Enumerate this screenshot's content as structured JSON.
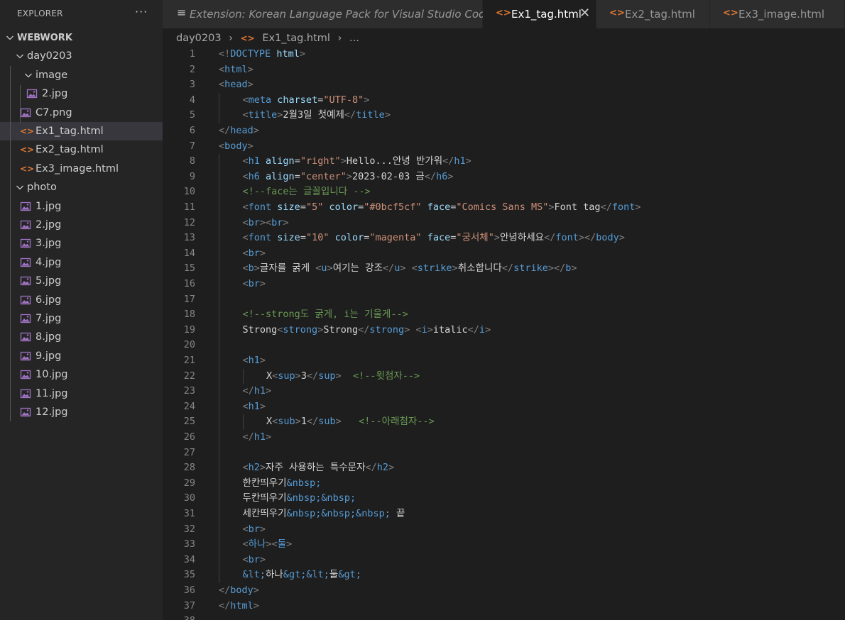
{
  "colors": {
    "tag": "#569cd6",
    "bracket": "#808080",
    "attribute": "#9cdcfe",
    "string": "#ce9178",
    "text": "#d4d4d4",
    "comment": "#6a9955",
    "html_icon": "#e37933",
    "image_icon": "#a074c4"
  },
  "sidebar": {
    "title": "EXPLORER",
    "more": "···",
    "tree": [
      {
        "label": "WEBWORK",
        "depth": 0,
        "kind": "folder",
        "expanded": true,
        "bold": true
      },
      {
        "label": "day0203",
        "depth": 1,
        "kind": "folder",
        "expanded": true
      },
      {
        "label": "image",
        "depth": 2,
        "kind": "folder",
        "expanded": true
      },
      {
        "label": "2.jpg",
        "depth": 3,
        "kind": "image"
      },
      {
        "label": "C7.png",
        "depth": 2,
        "kind": "image"
      },
      {
        "label": "Ex1_tag.html",
        "depth": 2,
        "kind": "html",
        "selected": true
      },
      {
        "label": "Ex2_tag.html",
        "depth": 2,
        "kind": "html"
      },
      {
        "label": "Ex3_image.html",
        "depth": 2,
        "kind": "html"
      },
      {
        "label": "photo",
        "depth": 1,
        "kind": "folder",
        "expanded": true
      },
      {
        "label": "1.jpg",
        "depth": 2,
        "kind": "image"
      },
      {
        "label": "2.jpg",
        "depth": 2,
        "kind": "image"
      },
      {
        "label": "3.jpg",
        "depth": 2,
        "kind": "image"
      },
      {
        "label": "4.jpg",
        "depth": 2,
        "kind": "image"
      },
      {
        "label": "5.jpg",
        "depth": 2,
        "kind": "image"
      },
      {
        "label": "6.jpg",
        "depth": 2,
        "kind": "image"
      },
      {
        "label": "7.jpg",
        "depth": 2,
        "kind": "image"
      },
      {
        "label": "8.jpg",
        "depth": 2,
        "kind": "image"
      },
      {
        "label": "9.jpg",
        "depth": 2,
        "kind": "image"
      },
      {
        "label": "10.jpg",
        "depth": 2,
        "kind": "image"
      },
      {
        "label": "11.jpg",
        "depth": 2,
        "kind": "image"
      },
      {
        "label": "12.jpg",
        "depth": 2,
        "kind": "image"
      }
    ]
  },
  "tabs": [
    {
      "label": "Extension: Korean Language Pack for Visual Studio Code",
      "icon": "≡",
      "kind": "extension",
      "italic": true
    },
    {
      "label": "Ex1_tag.html",
      "icon": "<>",
      "kind": "html",
      "active": true,
      "close": "✕"
    },
    {
      "label": "Ex2_tag.html",
      "icon": "<>",
      "kind": "html"
    },
    {
      "label": "Ex3_image.html",
      "icon": "<>",
      "kind": "html"
    }
  ],
  "breadcrumb": {
    "folder": "day0203",
    "file": "Ex1_tag.html",
    "symbol": "...",
    "separator": "›",
    "file_icon": "<>"
  },
  "editor": {
    "lines": [
      {
        "n": "1",
        "indent": 0,
        "tokens": [
          [
            "br",
            "<!"
          ],
          [
            "doc",
            "DOCTYPE"
          ],
          [
            "txt",
            " "
          ],
          [
            "attr",
            "html"
          ],
          [
            "br",
            ">"
          ]
        ]
      },
      {
        "n": "2",
        "indent": 0,
        "tokens": [
          [
            "br",
            "<"
          ],
          [
            "tag",
            "html"
          ],
          [
            "br",
            ">"
          ]
        ]
      },
      {
        "n": "3",
        "indent": 0,
        "tokens": [
          [
            "br",
            "<"
          ],
          [
            "tag",
            "head"
          ],
          [
            "br",
            ">"
          ]
        ]
      },
      {
        "n": "4",
        "indent": 1,
        "tokens": [
          [
            "br",
            "<"
          ],
          [
            "tag",
            "meta"
          ],
          [
            "txt",
            " "
          ],
          [
            "attr",
            "charset"
          ],
          [
            "txt",
            "="
          ],
          [
            "str",
            "\"UTF-8\""
          ],
          [
            "br",
            ">"
          ]
        ]
      },
      {
        "n": "5",
        "indent": 1,
        "tokens": [
          [
            "br",
            "<"
          ],
          [
            "tag",
            "title"
          ],
          [
            "br",
            ">"
          ],
          [
            "txt",
            "2월3일 첫예제"
          ],
          [
            "br",
            "</"
          ],
          [
            "tag",
            "title"
          ],
          [
            "br",
            ">"
          ]
        ]
      },
      {
        "n": "6",
        "indent": 0,
        "tokens": [
          [
            "br",
            "</"
          ],
          [
            "tag",
            "head"
          ],
          [
            "br",
            ">"
          ]
        ]
      },
      {
        "n": "7",
        "indent": 0,
        "tokens": [
          [
            "br",
            "<"
          ],
          [
            "tag",
            "body"
          ],
          [
            "br",
            ">"
          ]
        ]
      },
      {
        "n": "8",
        "indent": 1,
        "tokens": [
          [
            "br",
            "<"
          ],
          [
            "tag",
            "h1"
          ],
          [
            "txt",
            " "
          ],
          [
            "attr",
            "align"
          ],
          [
            "txt",
            "="
          ],
          [
            "str",
            "\"right\""
          ],
          [
            "br",
            ">"
          ],
          [
            "txt",
            "Hello...안녕 반가워"
          ],
          [
            "br",
            "</"
          ],
          [
            "tag",
            "h1"
          ],
          [
            "br",
            ">"
          ]
        ]
      },
      {
        "n": "9",
        "indent": 1,
        "tokens": [
          [
            "br",
            "<"
          ],
          [
            "tag",
            "h6"
          ],
          [
            "txt",
            " "
          ],
          [
            "attr",
            "align"
          ],
          [
            "txt",
            "="
          ],
          [
            "str",
            "\"center\""
          ],
          [
            "br",
            ">"
          ],
          [
            "txt",
            "2023-02-03 금"
          ],
          [
            "br",
            "</"
          ],
          [
            "tag",
            "h6"
          ],
          [
            "br",
            ">"
          ]
        ]
      },
      {
        "n": "10",
        "indent": 1,
        "tokens": [
          [
            "cmt",
            "<!--face는 글꼴입니다 -->"
          ]
        ]
      },
      {
        "n": "11",
        "indent": 1,
        "tokens": [
          [
            "br",
            "<"
          ],
          [
            "tag",
            "font"
          ],
          [
            "txt",
            " "
          ],
          [
            "attr",
            "size"
          ],
          [
            "txt",
            "="
          ],
          [
            "str",
            "\"5\""
          ],
          [
            "txt",
            " "
          ],
          [
            "attr",
            "color"
          ],
          [
            "txt",
            "="
          ],
          [
            "str",
            "\"#0bcf5cf\""
          ],
          [
            "txt",
            " "
          ],
          [
            "attr",
            "face"
          ],
          [
            "txt",
            "="
          ],
          [
            "str",
            "\"Comics Sans MS\""
          ],
          [
            "br",
            ">"
          ],
          [
            "txt",
            "Font tag"
          ],
          [
            "br",
            "</"
          ],
          [
            "tag",
            "font"
          ],
          [
            "br",
            ">"
          ]
        ]
      },
      {
        "n": "12",
        "indent": 1,
        "tokens": [
          [
            "br",
            "<"
          ],
          [
            "tag",
            "br"
          ],
          [
            "br",
            "><"
          ],
          [
            "tag",
            "br"
          ],
          [
            "br",
            ">"
          ]
        ]
      },
      {
        "n": "13",
        "indent": 1,
        "tokens": [
          [
            "br",
            "<"
          ],
          [
            "tag",
            "font"
          ],
          [
            "txt",
            " "
          ],
          [
            "attr",
            "size"
          ],
          [
            "txt",
            "="
          ],
          [
            "str",
            "\"10\""
          ],
          [
            "txt",
            " "
          ],
          [
            "attr",
            "color"
          ],
          [
            "txt",
            "="
          ],
          [
            "str",
            "\"magenta\""
          ],
          [
            "txt",
            " "
          ],
          [
            "attr",
            "face"
          ],
          [
            "txt",
            "="
          ],
          [
            "str",
            "\"궁서체\""
          ],
          [
            "br",
            ">"
          ],
          [
            "txt",
            "안녕하세요"
          ],
          [
            "br",
            "</"
          ],
          [
            "tag",
            "font"
          ],
          [
            "br",
            "></"
          ],
          [
            "tag",
            "body"
          ],
          [
            "br",
            ">"
          ]
        ]
      },
      {
        "n": "14",
        "indent": 1,
        "tokens": [
          [
            "br",
            "<"
          ],
          [
            "tag",
            "br"
          ],
          [
            "br",
            ">"
          ]
        ]
      },
      {
        "n": "15",
        "indent": 1,
        "tokens": [
          [
            "br",
            "<"
          ],
          [
            "tag",
            "b"
          ],
          [
            "br",
            ">"
          ],
          [
            "txt",
            "글자를 굵게 "
          ],
          [
            "br",
            "<"
          ],
          [
            "tag",
            "u"
          ],
          [
            "br",
            ">"
          ],
          [
            "txt",
            "여기는 강조"
          ],
          [
            "br",
            "</"
          ],
          [
            "tag",
            "u"
          ],
          [
            "br",
            ">"
          ],
          [
            "txt",
            " "
          ],
          [
            "br",
            "<"
          ],
          [
            "tag",
            "strike"
          ],
          [
            "br",
            ">"
          ],
          [
            "txt",
            "취소합니다"
          ],
          [
            "br",
            "</"
          ],
          [
            "tag",
            "strike"
          ],
          [
            "br",
            "></"
          ],
          [
            "tag",
            "b"
          ],
          [
            "br",
            ">"
          ]
        ]
      },
      {
        "n": "16",
        "indent": 1,
        "tokens": [
          [
            "br",
            "<"
          ],
          [
            "tag",
            "br"
          ],
          [
            "br",
            ">"
          ]
        ]
      },
      {
        "n": "17",
        "indent": 1,
        "tokens": []
      },
      {
        "n": "18",
        "indent": 1,
        "tokens": [
          [
            "cmt",
            "<!--strong도 굵게, i는 기울게-->"
          ]
        ]
      },
      {
        "n": "19",
        "indent": 1,
        "tokens": [
          [
            "txt",
            "Strong"
          ],
          [
            "br",
            "<"
          ],
          [
            "tag",
            "strong"
          ],
          [
            "br",
            ">"
          ],
          [
            "txt",
            "Strong"
          ],
          [
            "br",
            "</"
          ],
          [
            "tag",
            "strong"
          ],
          [
            "br",
            ">"
          ],
          [
            "txt",
            " "
          ],
          [
            "br",
            "<"
          ],
          [
            "tag",
            "i"
          ],
          [
            "br",
            ">"
          ],
          [
            "txt",
            "italic"
          ],
          [
            "br",
            "</"
          ],
          [
            "tag",
            "i"
          ],
          [
            "br",
            ">"
          ]
        ]
      },
      {
        "n": "20",
        "indent": 1,
        "tokens": []
      },
      {
        "n": "21",
        "indent": 1,
        "tokens": [
          [
            "br",
            "<"
          ],
          [
            "tag",
            "h1"
          ],
          [
            "br",
            ">"
          ]
        ]
      },
      {
        "n": "22",
        "indent": 2,
        "tokens": [
          [
            "txt",
            "X"
          ],
          [
            "br",
            "<"
          ],
          [
            "tag",
            "sup"
          ],
          [
            "br",
            ">"
          ],
          [
            "txt",
            "3"
          ],
          [
            "br",
            "</"
          ],
          [
            "tag",
            "sup"
          ],
          [
            "br",
            ">"
          ],
          [
            "txt",
            "  "
          ],
          [
            "cmt",
            "<!--윗첨자-->"
          ]
        ]
      },
      {
        "n": "23",
        "indent": 1,
        "tokens": [
          [
            "br",
            "</"
          ],
          [
            "tag",
            "h1"
          ],
          [
            "br",
            ">"
          ]
        ]
      },
      {
        "n": "24",
        "indent": 1,
        "tokens": [
          [
            "br",
            "<"
          ],
          [
            "tag",
            "h1"
          ],
          [
            "br",
            ">"
          ]
        ]
      },
      {
        "n": "25",
        "indent": 2,
        "tokens": [
          [
            "txt",
            "X"
          ],
          [
            "br",
            "<"
          ],
          [
            "tag",
            "sub"
          ],
          [
            "br",
            ">"
          ],
          [
            "txt",
            "1"
          ],
          [
            "br",
            "</"
          ],
          [
            "tag",
            "sub"
          ],
          [
            "br",
            ">"
          ],
          [
            "txt",
            "   "
          ],
          [
            "cmt",
            "<!--아래첨자-->"
          ]
        ]
      },
      {
        "n": "26",
        "indent": 1,
        "tokens": [
          [
            "br",
            "</"
          ],
          [
            "tag",
            "h1"
          ],
          [
            "br",
            ">"
          ]
        ]
      },
      {
        "n": "27",
        "indent": 1,
        "tokens": []
      },
      {
        "n": "28",
        "indent": 1,
        "tokens": [
          [
            "br",
            "<"
          ],
          [
            "tag",
            "h2"
          ],
          [
            "br",
            ">"
          ],
          [
            "txt",
            "자주 사용하는 특수문자"
          ],
          [
            "br",
            "</"
          ],
          [
            "tag",
            "h2"
          ],
          [
            "br",
            ">"
          ]
        ]
      },
      {
        "n": "29",
        "indent": 1,
        "tokens": [
          [
            "txt",
            "한칸띄우기"
          ],
          [
            "ent",
            "&nbsp;"
          ]
        ]
      },
      {
        "n": "30",
        "indent": 1,
        "tokens": [
          [
            "txt",
            "두칸띄우기"
          ],
          [
            "ent",
            "&nbsp;&nbsp;"
          ]
        ]
      },
      {
        "n": "31",
        "indent": 1,
        "tokens": [
          [
            "txt",
            "세칸띄우기"
          ],
          [
            "ent",
            "&nbsp;&nbsp;&nbsp;"
          ],
          [
            "txt",
            " 끝"
          ]
        ]
      },
      {
        "n": "32",
        "indent": 1,
        "tokens": [
          [
            "br",
            "<"
          ],
          [
            "tag",
            "br"
          ],
          [
            "br",
            ">"
          ]
        ]
      },
      {
        "n": "33",
        "indent": 1,
        "tokens": [
          [
            "br",
            "<"
          ],
          [
            "tag",
            "하나"
          ],
          [
            "br",
            "><"
          ],
          [
            "tag",
            "둘"
          ],
          [
            "br",
            ">"
          ]
        ]
      },
      {
        "n": "34",
        "indent": 1,
        "tokens": [
          [
            "br",
            "<"
          ],
          [
            "tag",
            "br"
          ],
          [
            "br",
            ">"
          ]
        ]
      },
      {
        "n": "35",
        "indent": 1,
        "tokens": [
          [
            "ent",
            "&lt;"
          ],
          [
            "txt",
            "하나"
          ],
          [
            "ent",
            "&gt;&lt;"
          ],
          [
            "txt",
            "둘"
          ],
          [
            "ent",
            "&gt;"
          ]
        ]
      },
      {
        "n": "36",
        "indent": 0,
        "tokens": [
          [
            "br",
            "</"
          ],
          [
            "tag",
            "body"
          ],
          [
            "br",
            ">"
          ]
        ]
      },
      {
        "n": "37",
        "indent": 0,
        "tokens": [
          [
            "br",
            "</"
          ],
          [
            "tag",
            "html"
          ],
          [
            "br",
            ">"
          ]
        ]
      },
      {
        "n": "38",
        "indent": 0,
        "tokens": []
      }
    ]
  }
}
